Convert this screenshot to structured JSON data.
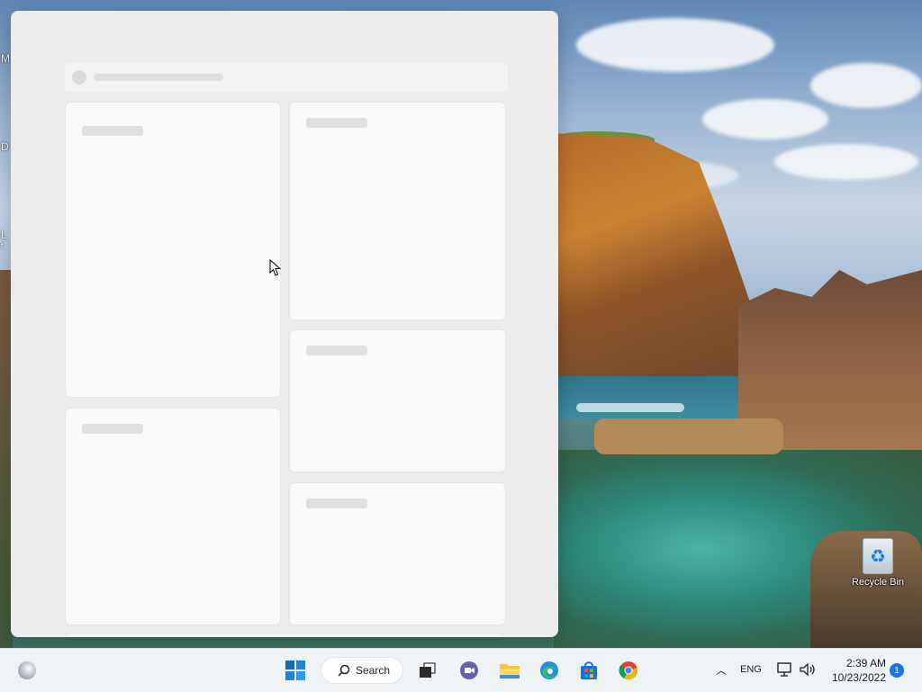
{
  "desktop": {
    "edge_letters": [
      "M",
      "D",
      "L",
      "t"
    ],
    "recycle_bin_label": "Recycle Bin"
  },
  "widgets_panel": {
    "state": "loading",
    "cards": 6
  },
  "taskbar": {
    "search_label": "Search",
    "language": "ENG",
    "time": "2:39 AM",
    "date": "10/23/2022",
    "notification_count": "1",
    "pinned_apps": [
      "Task View",
      "Chat",
      "File Explorer",
      "Microsoft Edge",
      "Microsoft Store",
      "Google Chrome"
    ]
  },
  "colors": {
    "accent": "#1a73e8",
    "panel_bg": "#ececec",
    "taskbar_bg": "#f0f3f6"
  }
}
